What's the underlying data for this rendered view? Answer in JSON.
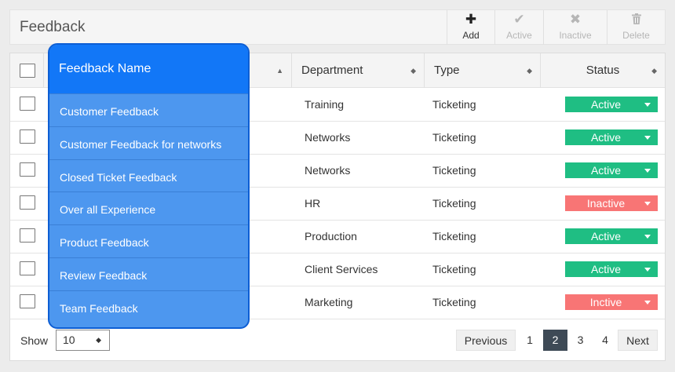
{
  "page": {
    "title": "Feedback"
  },
  "toolbar": {
    "add": {
      "label": "Add",
      "icon": "plus-icon"
    },
    "active": {
      "label": "Active",
      "icon": "check-icon"
    },
    "inactive": {
      "label": "Inactive",
      "icon": "close-icon"
    },
    "delete": {
      "label": "Delete",
      "icon": "trash-icon"
    }
  },
  "table": {
    "columns": {
      "department": "Department",
      "type": "Type",
      "status": "Status"
    },
    "rows": [
      {
        "department": "Training",
        "type": "Ticketing",
        "status": "Active"
      },
      {
        "department": "Networks",
        "type": "Ticketing",
        "status": "Active"
      },
      {
        "department": "Networks",
        "type": "Ticketing",
        "status": "Active"
      },
      {
        "department": "HR",
        "type": "Ticketing",
        "status": "Inactive"
      },
      {
        "department": "Production",
        "type": "Ticketing",
        "status": "Active"
      },
      {
        "department": "Client Services",
        "type": "Ticketing",
        "status": "Active"
      },
      {
        "department": "Marketing",
        "type": "Ticketing",
        "status": "Inctive"
      }
    ]
  },
  "dropdown": {
    "header": "Feedback Name",
    "items": [
      "Customer Feedback",
      "Customer Feedback for networks",
      "Closed Ticket Feedback",
      "Over all Experience",
      "Product Feedback",
      "Review Feedback",
      "Team Feedback"
    ]
  },
  "footer": {
    "show_label": "Show",
    "page_size": "10",
    "previous": "Previous",
    "pages": [
      "1",
      "2",
      "3",
      "4"
    ],
    "current_page": "2",
    "next": "Next"
  },
  "colors": {
    "active": "#1fbe83",
    "inactive": "#f87575",
    "accent": "#1277f7"
  }
}
